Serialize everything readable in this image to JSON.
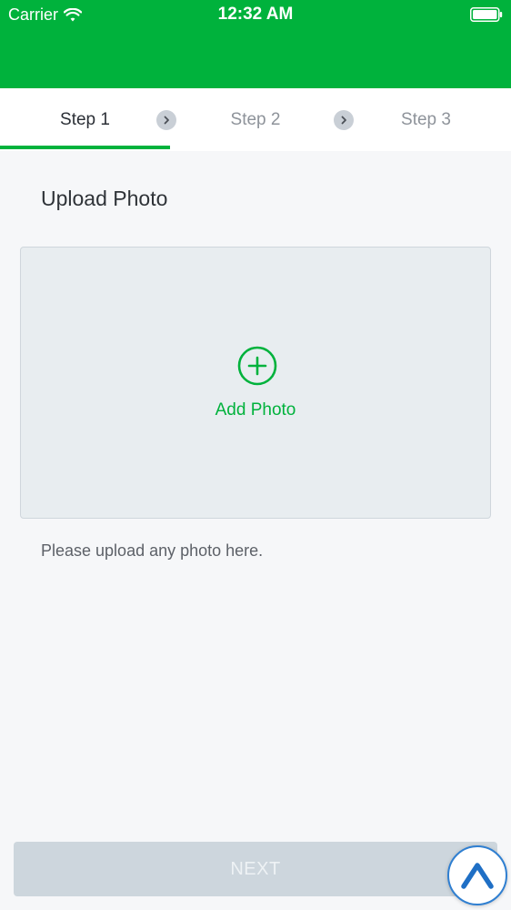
{
  "status_bar": {
    "carrier": "Carrier",
    "time": "12:32 AM",
    "wifi_icon": "wifi-icon",
    "battery_icon": "battery-icon"
  },
  "stepper": {
    "steps": [
      {
        "label": "Step 1",
        "active": true
      },
      {
        "label": "Step 2",
        "active": false
      },
      {
        "label": "Step 3",
        "active": false
      }
    ],
    "separator_icon": "chevron-right-icon"
  },
  "upload": {
    "title": "Upload Photo",
    "add_label": "Add Photo",
    "add_icon": "plus-circle-icon",
    "hint": "Please upload any photo here."
  },
  "footer": {
    "next_label": "NEXT",
    "fab_icon": "caret-up-icon"
  },
  "colors": {
    "brand": "#00b23c",
    "background": "#f6f7f9",
    "upload_area": "#e8edf0",
    "button_disabled": "#cdd6dd",
    "fab_accent": "#2f7fd1"
  }
}
